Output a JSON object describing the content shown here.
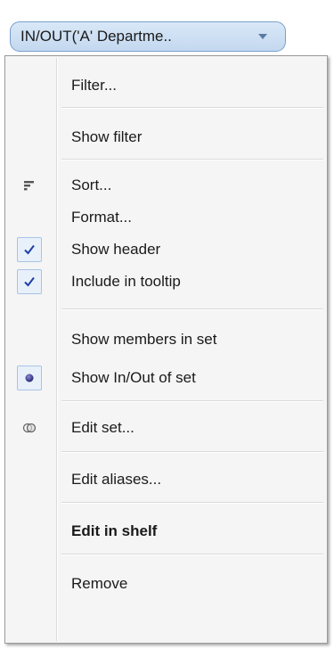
{
  "field_pill": {
    "label": "IN/OUT('A' Departme.."
  },
  "menu": {
    "items": [
      {
        "label": "Filter..."
      },
      {
        "label": "Show filter"
      },
      {
        "label": "Sort..."
      },
      {
        "label": "Format..."
      },
      {
        "label": "Show header",
        "checked": true
      },
      {
        "label": "Include in tooltip",
        "checked": true
      },
      {
        "label": "Show members in set"
      },
      {
        "label": "Show In/Out of set",
        "selected": true
      },
      {
        "label": "Edit set..."
      },
      {
        "label": "Edit aliases..."
      },
      {
        "label": "Edit in shelf"
      },
      {
        "label": "Remove"
      }
    ]
  },
  "icons": {
    "sort": "sort-icon",
    "check": "checkmark-icon",
    "radio": "radio-dot-icon",
    "edit_set": "venn-icon",
    "dropdown": "dropdown-arrow-icon"
  },
  "colors": {
    "pill_fill": "#c9dcf1",
    "pill_border": "#7a9fc9",
    "check_color": "#1c3fa8",
    "menu_bg": "#f5f5f5"
  }
}
